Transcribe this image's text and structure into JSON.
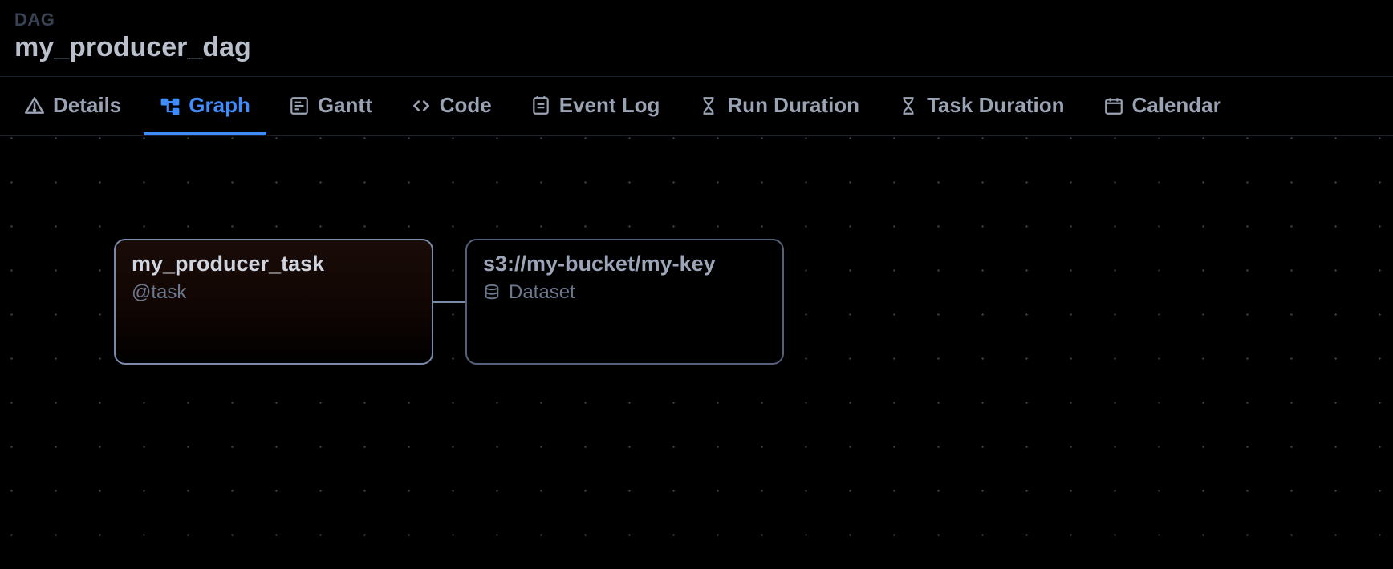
{
  "header": {
    "eyebrow": "DAG",
    "title": "my_producer_dag"
  },
  "tabs": [
    {
      "id": "details",
      "label": "Details",
      "icon": "alert-triangle-icon",
      "active": false
    },
    {
      "id": "graph",
      "label": "Graph",
      "icon": "graph-icon",
      "active": true
    },
    {
      "id": "gantt",
      "label": "Gantt",
      "icon": "gantt-icon",
      "active": false
    },
    {
      "id": "code",
      "label": "Code",
      "icon": "code-icon",
      "active": false
    },
    {
      "id": "event-log",
      "label": "Event Log",
      "icon": "event-log-icon",
      "active": false
    },
    {
      "id": "run-duration",
      "label": "Run Duration",
      "icon": "hourglass-icon",
      "active": false
    },
    {
      "id": "task-duration",
      "label": "Task Duration",
      "icon": "hourglass-icon",
      "active": false
    },
    {
      "id": "calendar",
      "label": "Calendar",
      "icon": "calendar-icon",
      "active": false
    }
  ],
  "graph": {
    "nodes": {
      "task": {
        "title": "my_producer_task",
        "subtitle": "@task"
      },
      "dataset": {
        "title": "s3://my-bucket/my-key",
        "subtitle": "Dataset"
      }
    }
  }
}
